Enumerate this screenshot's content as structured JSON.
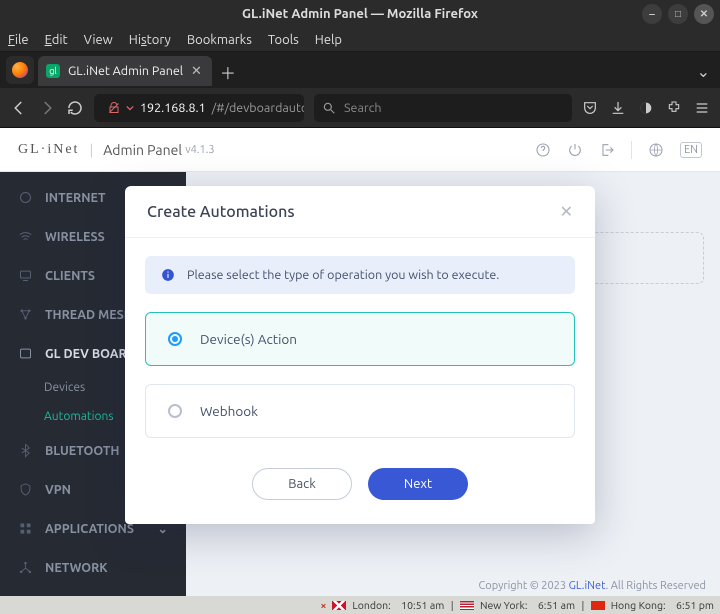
{
  "window": {
    "title": "GL.iNet Admin Panel — Mozilla Firefox"
  },
  "menu": {
    "file": "File",
    "edit": "Edit",
    "view": "View",
    "history": "History",
    "bookmarks": "Bookmarks",
    "tools": "Tools",
    "help": "Help"
  },
  "tab": {
    "title": "GL.iNet Admin Panel"
  },
  "url": {
    "ip": "192.168.8.1",
    "rest": "/#/devboardautom"
  },
  "searchbox": {
    "placeholder": "Search"
  },
  "app": {
    "brand": "GL·iNet",
    "panel_label": "Admin Panel",
    "version": "v4.1.3",
    "lang": "EN"
  },
  "sidebar": {
    "internet": "INTERNET",
    "wireless": "WIRELESS",
    "clients": "CLIENTS",
    "thread": "THREAD MESH",
    "devboard": "GL DEV BOARD",
    "devices": "Devices",
    "automations": "Automations",
    "bluetooth": "BLUETOOTH",
    "vpn": "VPN",
    "applications": "APPLICATIONS",
    "network": "NETWORK"
  },
  "modal": {
    "title": "Create Automations",
    "info": "Please select the type of operation you wish to execute.",
    "opt1": "Device(s) Action",
    "opt2": "Webhook",
    "back": "Back",
    "next": "Next"
  },
  "footer": {
    "copyright_pre": "Copyright © 2023 ",
    "copyright_link": "GL.iNet",
    "copyright_post": ". All Rights Reserved"
  },
  "clocks": {
    "london_label": "London:",
    "london_time": "10:51 am",
    "ny_label": "New York:",
    "ny_time": "6:51 am",
    "hk_label": "Hong Kong:",
    "hk_time": "6:51 pm"
  }
}
